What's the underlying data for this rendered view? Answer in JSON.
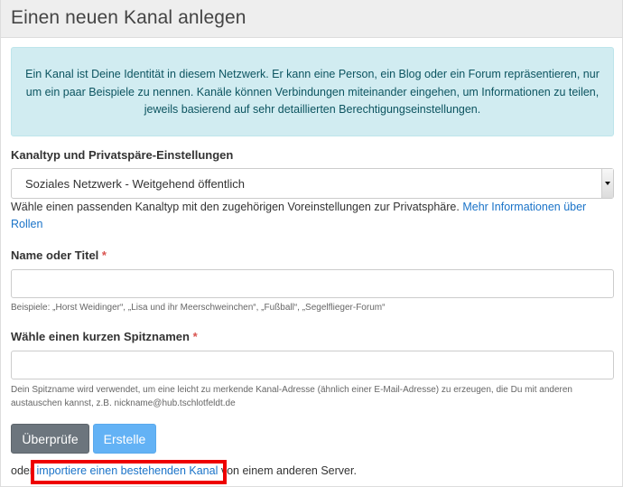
{
  "header": {
    "title": "Einen neuen Kanal anlegen"
  },
  "info_alert": {
    "text": "Ein Kanal ist Deine Identität in diesem Netzwerk. Er kann eine Person, ein Blog oder ein Forum repräsentieren, nur um ein paar Beispiele zu nennen. Kanäle können Verbindungen miteinander eingehen, um Informationen zu teilen, jeweils basierend auf sehr detaillierten Berechtigungseinstellungen."
  },
  "channel_type": {
    "label": "Kanaltyp und Privatspäre-Einstellungen",
    "selected": "Soziales Netzwerk - Weitgehend öffentlich",
    "help": "Wähle einen passenden Kanaltyp mit den zugehörigen Voreinstellungen zur Privatsphäre.",
    "help_link": "Mehr Informationen über Rollen"
  },
  "name_field": {
    "label": "Name oder Titel",
    "required_mark": "*",
    "value": "",
    "hint": "Beispiele: „Horst Weidinger“, „Lisa und ihr Meerschweinchen“, „Fußball“, „Segelflieger-Forum“"
  },
  "nick_field": {
    "label": "Wähle einen kurzen Spitznamen",
    "required_mark": "*",
    "value": "",
    "hint": "Dein Spitzname wird verwendet, um eine leicht zu merkende Kanal-Adresse (ähnlich einer E-Mail-Adresse) zu erzeugen, die Du mit anderen austauschen kannst, z.B. nickname@hub.tschlotfeldt.de"
  },
  "buttons": {
    "check": "Überprüfe",
    "create": "Erstelle"
  },
  "import": {
    "prefix": "oder",
    "link": "importiere einen bestehenden Kanal",
    "suffix": "von einem anderen Server."
  },
  "colors": {
    "alert_bg": "#d1ecf1",
    "alert_text": "#0c5460",
    "link": "#1a73c8",
    "check_button": "#6c757d",
    "create_button": "#63b2f5",
    "required": "#d9534f",
    "highlight": "#ee0000"
  }
}
